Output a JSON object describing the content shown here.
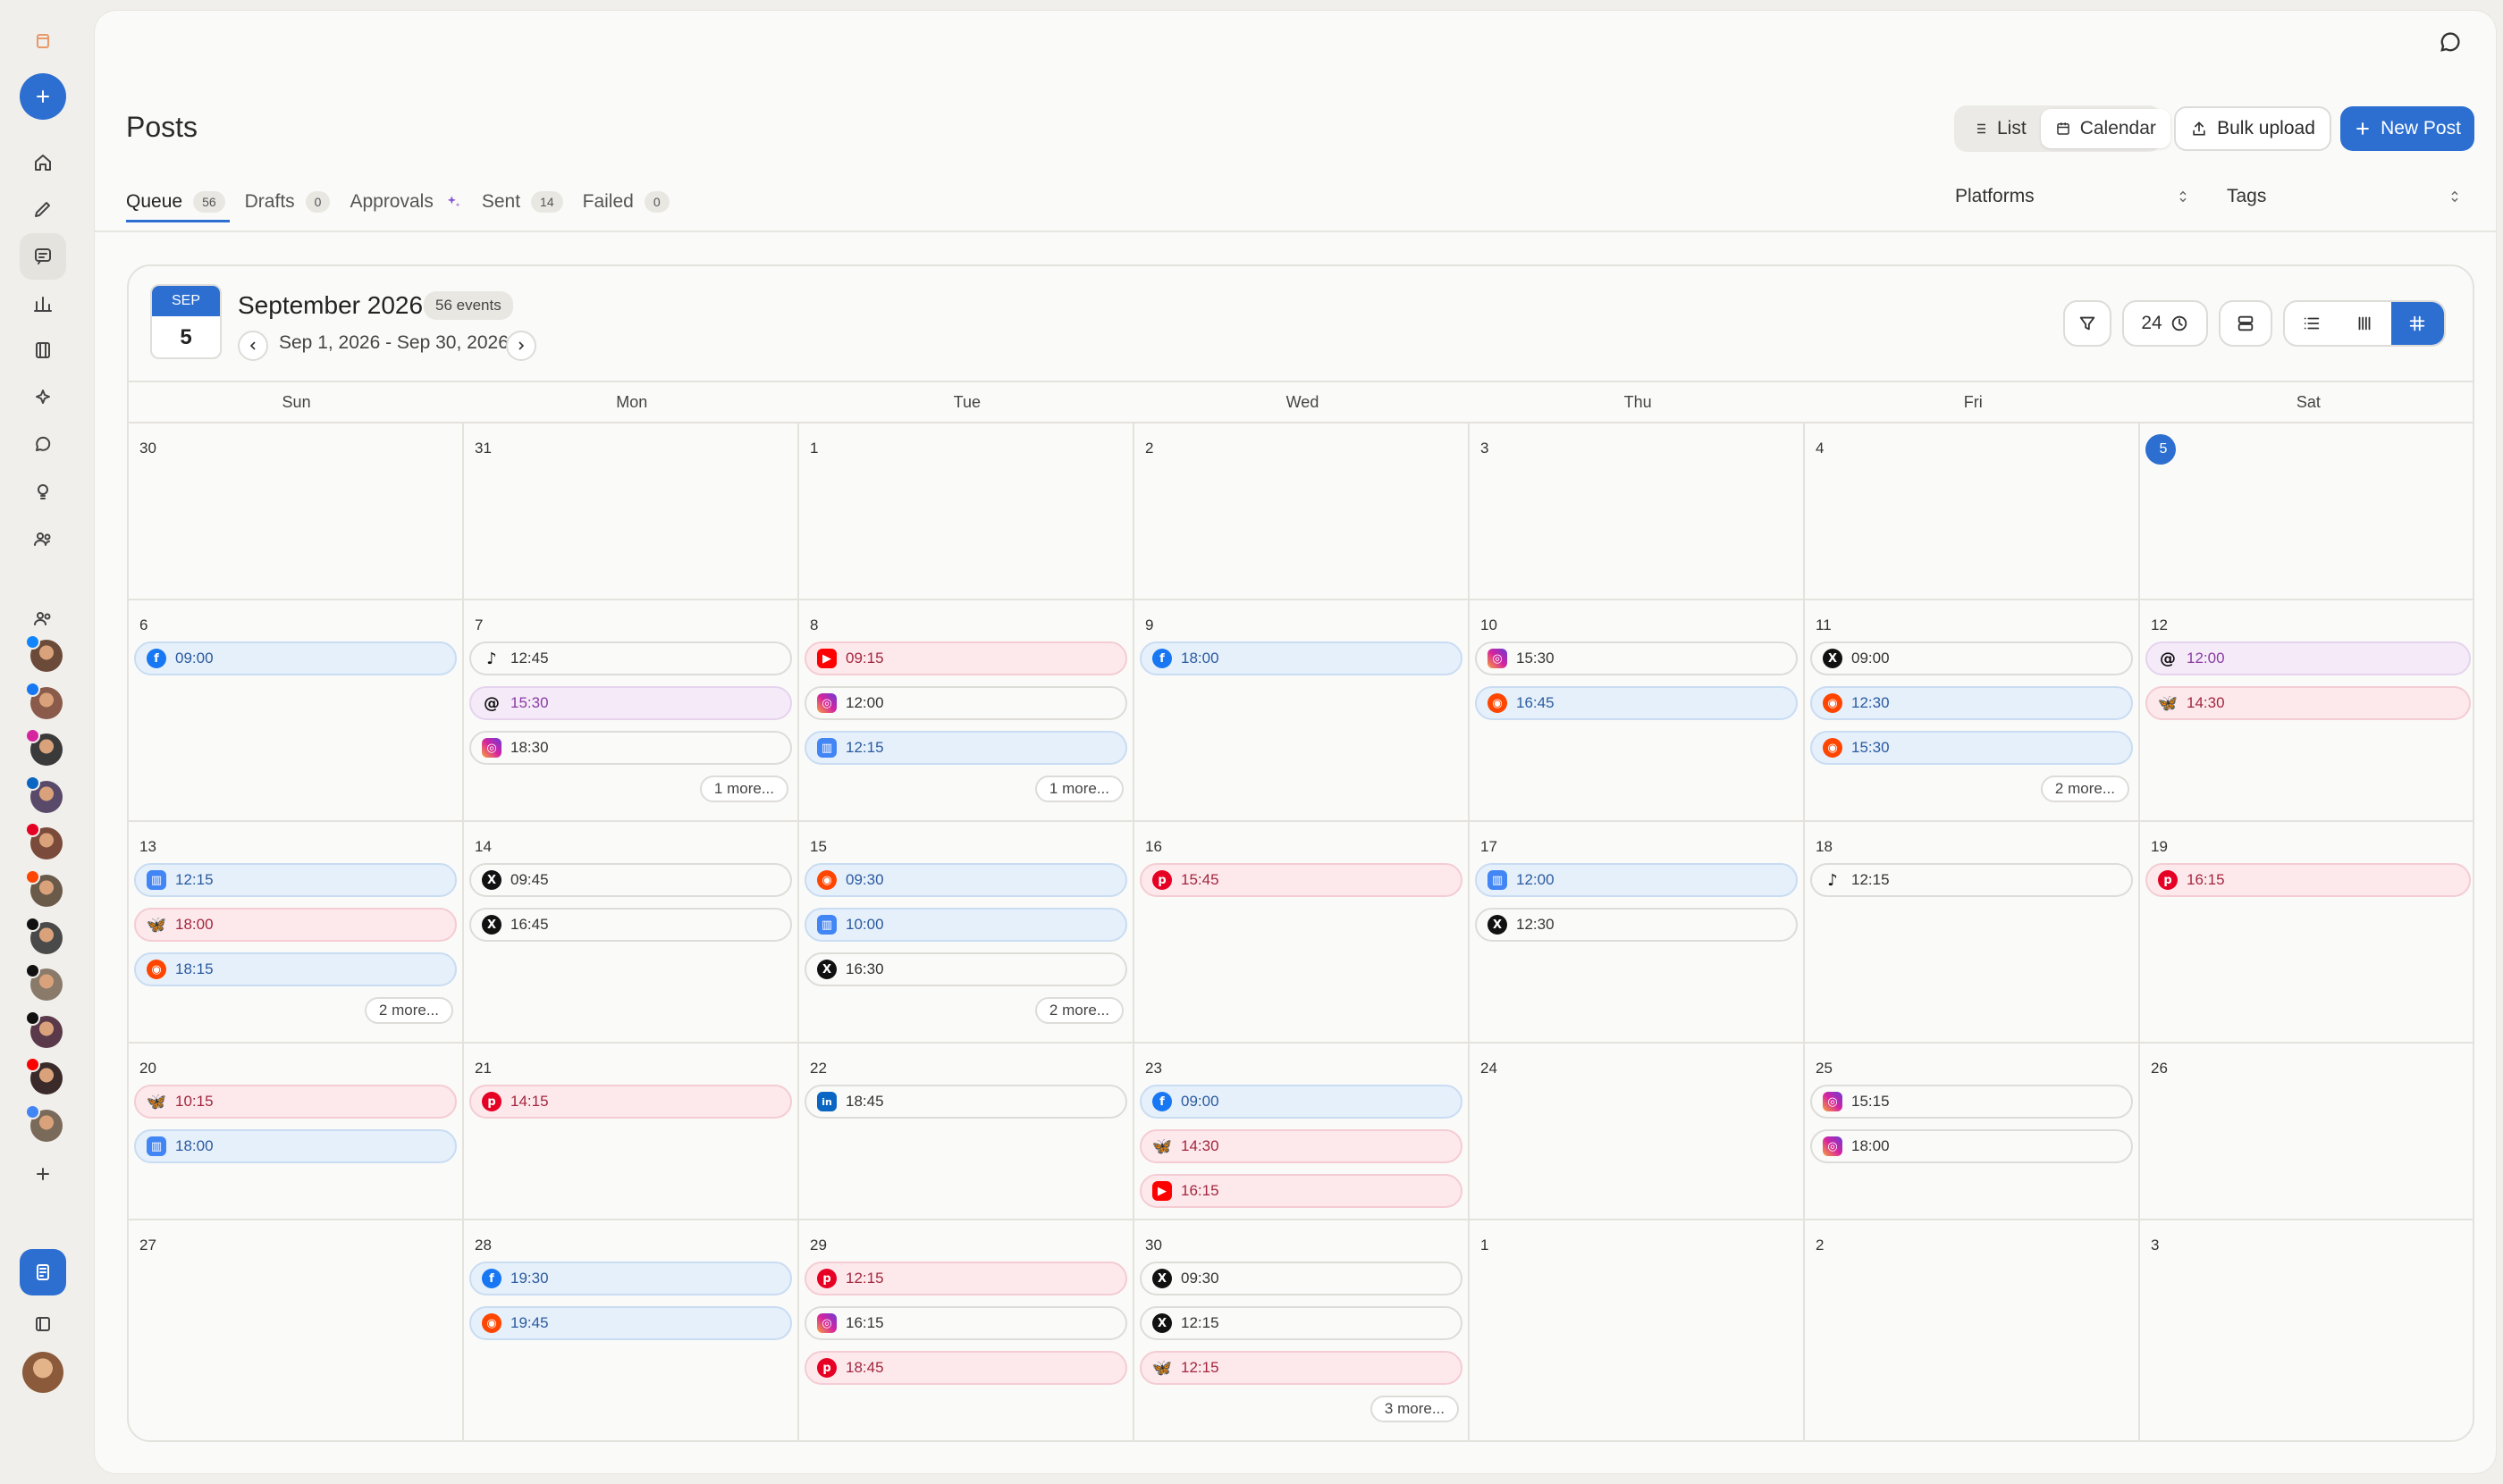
{
  "header": {
    "title": "Posts",
    "view_list": "List",
    "view_calendar": "Calendar",
    "bulk_upload": "Bulk upload",
    "new_post": "New Post"
  },
  "tabs": [
    {
      "label": "Queue",
      "count": "56"
    },
    {
      "label": "Drafts",
      "count": "0"
    },
    {
      "label": "Approvals",
      "count": ""
    },
    {
      "label": "Sent",
      "count": "14"
    },
    {
      "label": "Failed",
      "count": "0"
    }
  ],
  "filters": {
    "platforms": "Platforms",
    "tags": "Tags"
  },
  "calendar": {
    "tile_month": "SEP",
    "tile_day": "5",
    "title": "September 2026",
    "events_badge": "56 events",
    "range": "Sep 1, 2026 - Sep 30, 2026",
    "time_format": "24",
    "weekdays": [
      "Sun",
      "Mon",
      "Tue",
      "Wed",
      "Thu",
      "Fri",
      "Sat"
    ],
    "weeks": [
      [
        {
          "day": "30",
          "events": []
        },
        {
          "day": "31",
          "events": []
        },
        {
          "day": "1",
          "events": []
        },
        {
          "day": "2",
          "events": []
        },
        {
          "day": "3",
          "events": []
        },
        {
          "day": "4",
          "events": []
        },
        {
          "day": "5",
          "today": true,
          "events": []
        }
      ],
      [
        {
          "day": "6",
          "events": [
            {
              "time": "09:00",
              "net": "facebook",
              "style": "blue"
            }
          ]
        },
        {
          "day": "7",
          "events": [
            {
              "time": "12:45",
              "net": "tiktok",
              "style": "neutral"
            },
            {
              "time": "15:30",
              "net": "threads",
              "style": "purple"
            },
            {
              "time": "18:30",
              "net": "instagram",
              "style": "neutral"
            }
          ],
          "more": "1 more..."
        },
        {
          "day": "8",
          "events": [
            {
              "time": "09:15",
              "net": "youtube",
              "style": "pink"
            },
            {
              "time": "12:00",
              "net": "instagram",
              "style": "neutral"
            },
            {
              "time": "12:15",
              "net": "gbusiness",
              "style": "blue"
            }
          ],
          "more": "1 more..."
        },
        {
          "day": "9",
          "events": [
            {
              "time": "18:00",
              "net": "facebook",
              "style": "blue"
            }
          ]
        },
        {
          "day": "10",
          "events": [
            {
              "time": "15:30",
              "net": "instagram",
              "style": "neutral"
            },
            {
              "time": "16:45",
              "net": "reddit",
              "style": "blue"
            }
          ]
        },
        {
          "day": "11",
          "events": [
            {
              "time": "09:00",
              "net": "x",
              "style": "neutral"
            },
            {
              "time": "12:30",
              "net": "reddit",
              "style": "blue"
            },
            {
              "time": "15:30",
              "net": "reddit",
              "style": "blue"
            }
          ],
          "more": "2 more..."
        },
        {
          "day": "12",
          "events": [
            {
              "time": "12:00",
              "net": "threads",
              "style": "purple"
            },
            {
              "time": "14:30",
              "net": "bluesky",
              "style": "pink"
            }
          ]
        }
      ],
      [
        {
          "day": "13",
          "events": [
            {
              "time": "12:15",
              "net": "gbusiness",
              "style": "blue"
            },
            {
              "time": "18:00",
              "net": "bluesky",
              "style": "pink"
            },
            {
              "time": "18:15",
              "net": "reddit",
              "style": "blue"
            }
          ],
          "more": "2 more..."
        },
        {
          "day": "14",
          "events": [
            {
              "time": "09:45",
              "net": "x",
              "style": "neutral"
            },
            {
              "time": "16:45",
              "net": "x",
              "style": "neutral"
            }
          ]
        },
        {
          "day": "15",
          "events": [
            {
              "time": "09:30",
              "net": "reddit",
              "style": "blue"
            },
            {
              "time": "10:00",
              "net": "gbusiness",
              "style": "blue"
            },
            {
              "time": "16:30",
              "net": "x",
              "style": "neutral"
            }
          ],
          "more": "2 more..."
        },
        {
          "day": "16",
          "events": [
            {
              "time": "15:45",
              "net": "pinterest",
              "style": "pink"
            }
          ]
        },
        {
          "day": "17",
          "events": [
            {
              "time": "12:00",
              "net": "gbusiness",
              "style": "blue"
            },
            {
              "time": "12:30",
              "net": "x",
              "style": "neutral"
            }
          ]
        },
        {
          "day": "18",
          "events": [
            {
              "time": "12:15",
              "net": "tiktok",
              "style": "neutral"
            }
          ]
        },
        {
          "day": "19",
          "events": [
            {
              "time": "16:15",
              "net": "pinterest",
              "style": "pink"
            }
          ]
        }
      ],
      [
        {
          "day": "20",
          "events": [
            {
              "time": "10:15",
              "net": "bluesky",
              "style": "pink"
            },
            {
              "time": "18:00",
              "net": "gbusiness",
              "style": "blue"
            }
          ]
        },
        {
          "day": "21",
          "events": [
            {
              "time": "14:15",
              "net": "pinterest",
              "style": "pink"
            }
          ]
        },
        {
          "day": "22",
          "events": [
            {
              "time": "18:45",
              "net": "linkedin",
              "style": "neutral"
            }
          ]
        },
        {
          "day": "23",
          "events": [
            {
              "time": "09:00",
              "net": "facebook",
              "style": "blue"
            },
            {
              "time": "14:30",
              "net": "bluesky",
              "style": "pink"
            },
            {
              "time": "16:15",
              "net": "youtube",
              "style": "pink"
            }
          ]
        },
        {
          "day": "24",
          "events": []
        },
        {
          "day": "25",
          "events": [
            {
              "time": "15:15",
              "net": "instagram",
              "style": "neutral"
            },
            {
              "time": "18:00",
              "net": "instagram",
              "style": "neutral"
            }
          ]
        },
        {
          "day": "26",
          "events": []
        }
      ],
      [
        {
          "day": "27",
          "events": []
        },
        {
          "day": "28",
          "events": [
            {
              "time": "19:30",
              "net": "facebook",
              "style": "blue"
            },
            {
              "time": "19:45",
              "net": "reddit",
              "style": "blue"
            }
          ]
        },
        {
          "day": "29",
          "events": [
            {
              "time": "12:15",
              "net": "pinterest",
              "style": "pink"
            },
            {
              "time": "16:15",
              "net": "instagram",
              "style": "neutral"
            },
            {
              "time": "18:45",
              "net": "pinterest",
              "style": "pink"
            }
          ]
        },
        {
          "day": "30",
          "events": [
            {
              "time": "09:30",
              "net": "x",
              "style": "neutral"
            },
            {
              "time": "12:15",
              "net": "x",
              "style": "neutral"
            },
            {
              "time": "12:15",
              "net": "bluesky",
              "style": "pink"
            }
          ],
          "more": "3 more..."
        },
        {
          "day": "1",
          "events": []
        },
        {
          "day": "2",
          "events": []
        },
        {
          "day": "3",
          "events": []
        }
      ]
    ]
  },
  "sidebar": {
    "accounts": [
      "bluesky",
      "facebook",
      "instagram",
      "linkedin",
      "pinterest",
      "reddit",
      "threads",
      "tiktok",
      "x",
      "youtube",
      "gbusiness"
    ]
  },
  "colors": {
    "accent": "#2c6fd1",
    "facebook": "#1877f2",
    "instagram": "#d6249f",
    "youtube": "#ff0000",
    "pinterest": "#e60023",
    "reddit": "#ff4500",
    "bluesky": "#1185fe",
    "linkedin": "#0a66c2",
    "x": "#111111",
    "tiktok": "#111111",
    "threads": "#111111",
    "gbusiness": "#4285f4"
  }
}
